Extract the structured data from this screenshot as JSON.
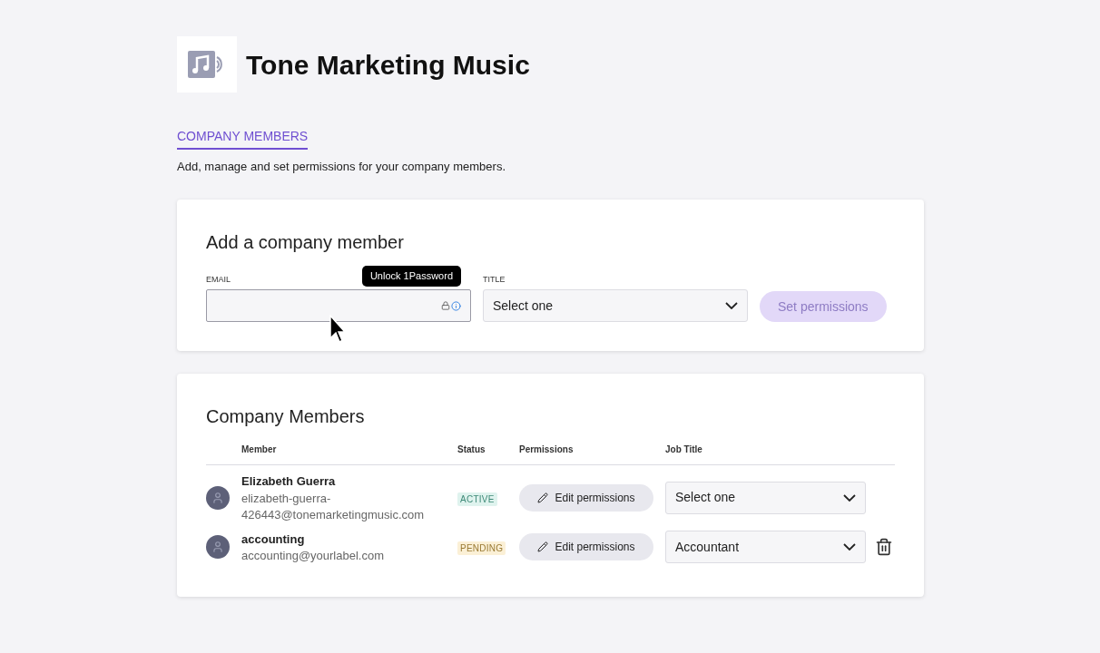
{
  "company": {
    "name": "Tone Marketing Music"
  },
  "tabs": [
    {
      "label": "COMPANY MEMBERS",
      "selected": true
    }
  ],
  "description": "Add, manage and set permissions for your company members.",
  "add_member": {
    "title": "Add a company member",
    "email": {
      "label": "EMAIL"
    },
    "tooltip": "Unlock 1Password",
    "title_field": {
      "label": "TITLE",
      "value": "Select one"
    },
    "submit": {
      "label": "Set permissions",
      "disabled": true
    }
  },
  "members": {
    "title": "Company Members",
    "columns": [
      "Member",
      "Status",
      "Permissions",
      "Job Title"
    ],
    "rows": [
      {
        "name": "Elizabeth Guerra",
        "email": "elizabeth-guerra-426443@tonemarketingmusic.com",
        "status": {
          "label": "ACTIVE",
          "kind": "active"
        },
        "permissions": "Edit permissions",
        "job_title": "Select one",
        "deletable": false
      },
      {
        "name": "accounting",
        "email": "accounting@yourlabel.com",
        "status": {
          "label": "PENDING",
          "kind": "pending"
        },
        "permissions": "Edit permissions",
        "job_title": "Accountant",
        "deletable": true
      }
    ]
  }
}
